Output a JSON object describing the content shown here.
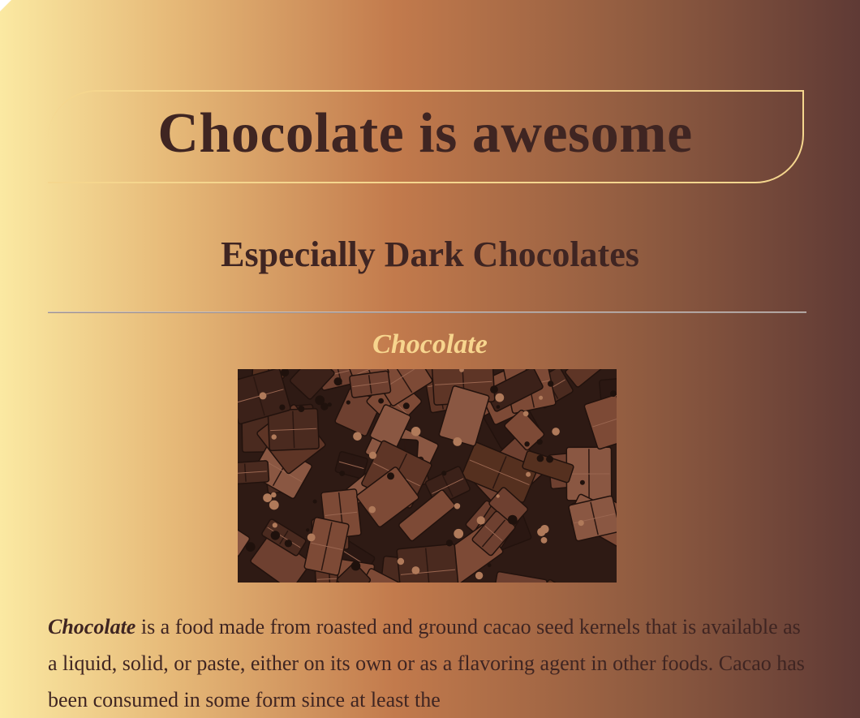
{
  "page": {
    "title": "Chocolate is awesome",
    "subtitle": "Especially Dark Chocolates",
    "figure": {
      "caption": "Chocolate",
      "image_description_icon": "chocolate-photo"
    },
    "paragraph": {
      "term": "Chocolate",
      "text": " is a food made from roasted and ground cacao seed kernels that is available as a liquid, solid, or paste, either on its own or as a flavoring agent in other foods. Cacao has been consumed in some form since at least the"
    }
  },
  "colors": {
    "text": "#3f2522",
    "accent": "#f7d58e",
    "gradient_start": "#fbe9a2",
    "gradient_mid": "#c27a4c",
    "gradient_end": "#5f3a35"
  }
}
